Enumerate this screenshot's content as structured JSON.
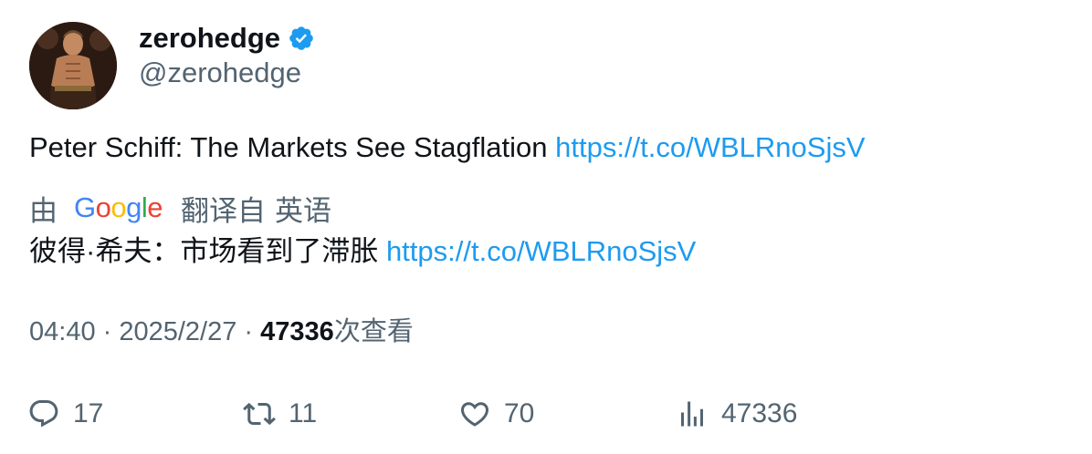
{
  "author": {
    "display_name": "zerohedge",
    "handle": "@zerohedge",
    "verified": true,
    "verified_color": "#1d9bf0"
  },
  "tweet": {
    "text": "Peter Schiff: The Markets See Stagflation ",
    "link": "https://t.co/WBLRnoSjsV"
  },
  "translation": {
    "by_label": "由",
    "provider": "Google",
    "translated_from_label": "翻译自",
    "source_language": "英语",
    "text": "彼得·希夫：市场看到了滞胀 ",
    "link": "https://t.co/WBLRnoSjsV"
  },
  "meta": {
    "time": "04:40",
    "separator1": " · ",
    "date": "2025/2/27",
    "separator2": " · ",
    "views_count": "47336",
    "views_label": "次查看"
  },
  "actions": {
    "reply_count": "17",
    "retweet_count": "11",
    "like_count": "70",
    "views_count": "47336"
  },
  "colors": {
    "link": "#1d9bf0",
    "secondary_text": "#536471",
    "primary_text": "#0f1419"
  }
}
